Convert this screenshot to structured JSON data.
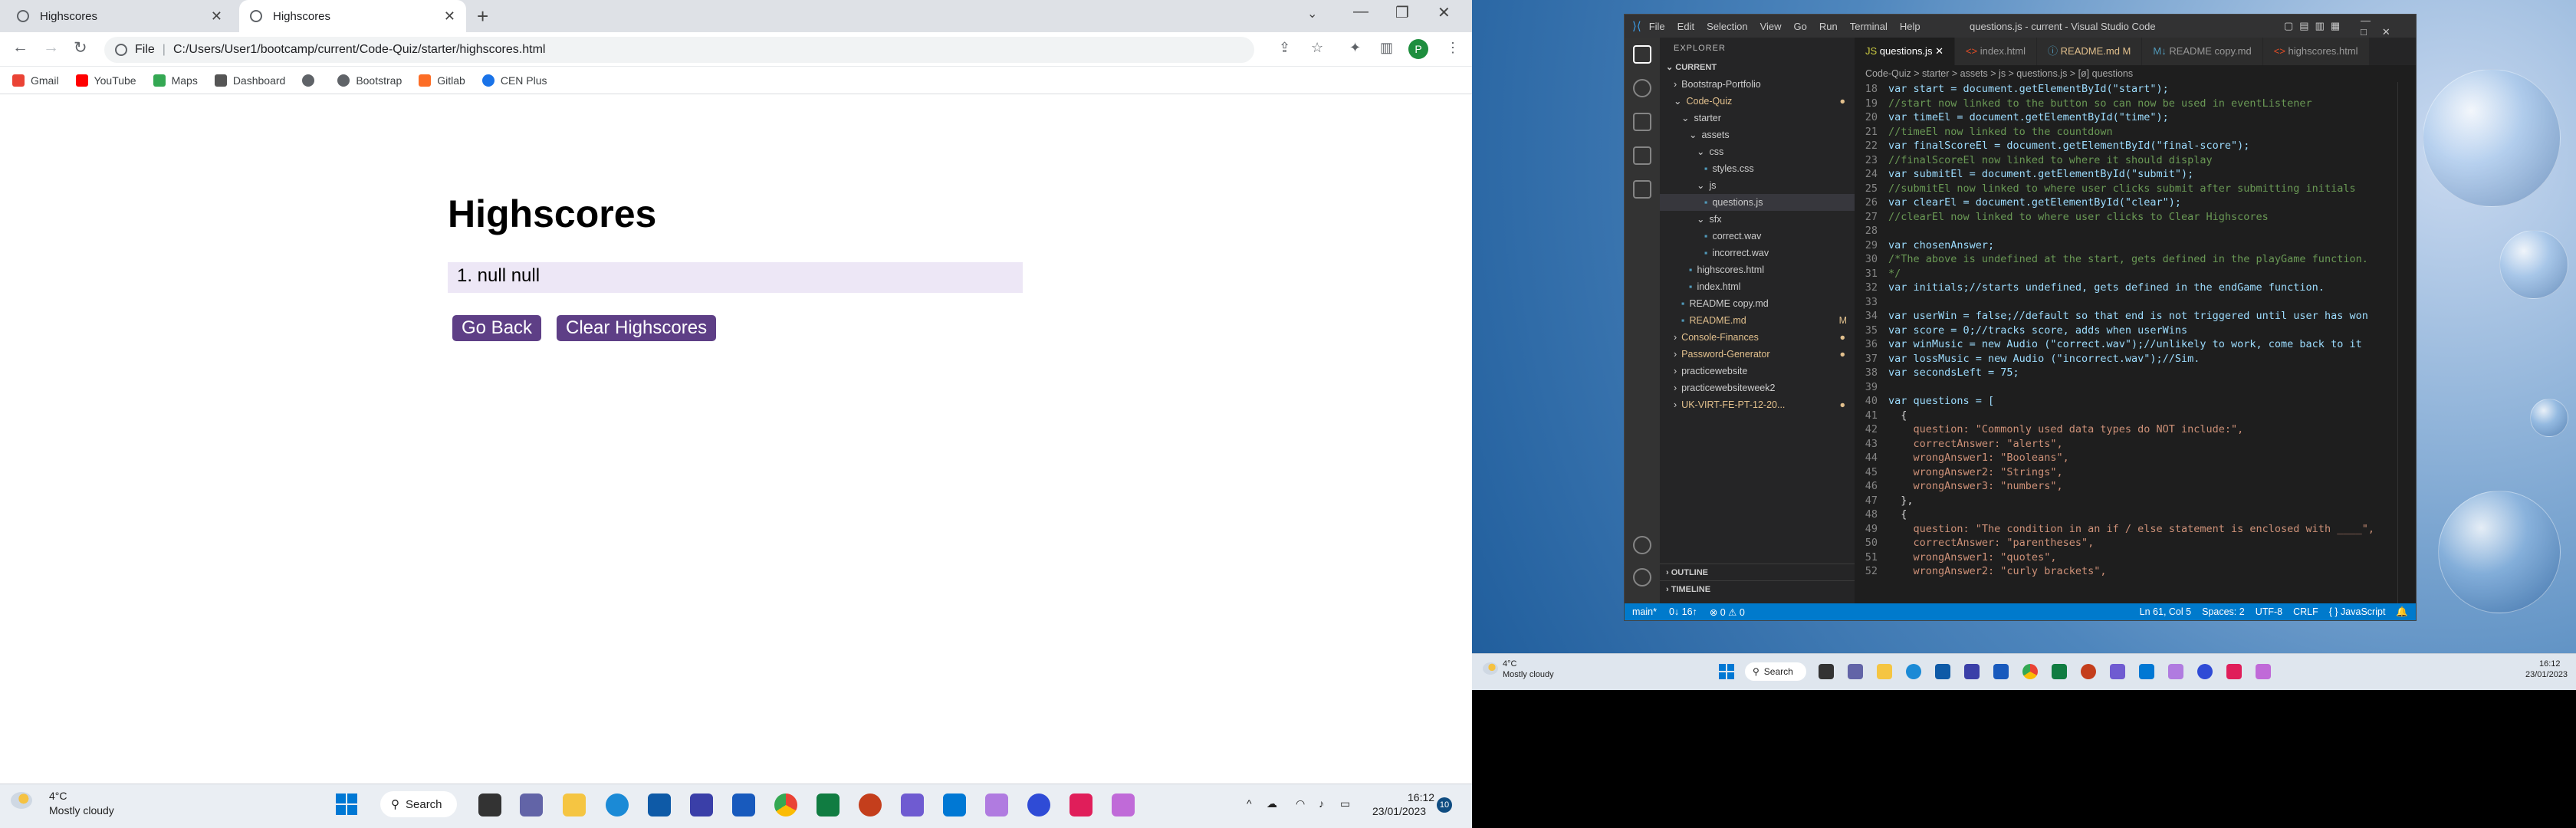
{
  "browser": {
    "tabs": [
      {
        "title": "Highscores"
      },
      {
        "title": "Highscores"
      }
    ],
    "url_prefix": "File",
    "url": "C:/Users/User1/bootcamp/current/Code-Quiz/starter/highscores.html",
    "profile_initial": "P",
    "bookmarks": [
      {
        "label": "Gmail",
        "color": "#ea4335"
      },
      {
        "label": "YouTube",
        "color": "#ff0000"
      },
      {
        "label": "Maps",
        "color": "#34a853"
      },
      {
        "label": "Dashboard",
        "color": "#555555"
      },
      {
        "label": "",
        "color": "#5f6368"
      },
      {
        "label": "Bootstrap",
        "color": "#5f6368"
      },
      {
        "label": "Gitlab",
        "color": "#fc6d26"
      },
      {
        "label": "CEN Plus",
        "color": "#1a73e8"
      }
    ]
  },
  "page": {
    "heading": "Highscores",
    "scores": [
      "1. null null"
    ],
    "go_back": "Go Back",
    "clear": "Clear Highscores"
  },
  "taskbar_left": {
    "weather_temp": "4°C",
    "weather_desc": "Mostly cloudy",
    "search": "Search",
    "time": "16:12",
    "date": "23/01/2023",
    "notification_count": "10"
  },
  "vscode": {
    "menu": [
      "File",
      "Edit",
      "Selection",
      "View",
      "Go",
      "Run",
      "Terminal",
      "Help"
    ],
    "title": "questions.js - current - Visual Studio Code",
    "explorer_label": "EXPLORER",
    "current_label": "CURRENT",
    "tree": [
      {
        "label": "Bootstrap-Portfolio",
        "indent": 1,
        "kind": "folder-closed"
      },
      {
        "label": "Code-Quiz",
        "indent": 1,
        "kind": "folder-open",
        "color": "#e2c08d"
      },
      {
        "label": "starter",
        "indent": 2,
        "kind": "folder-open"
      },
      {
        "label": "assets",
        "indent": 3,
        "kind": "folder-open"
      },
      {
        "label": "css",
        "indent": 4,
        "kind": "folder-open"
      },
      {
        "label": "styles.css",
        "indent": 5,
        "kind": "file"
      },
      {
        "label": "js",
        "indent": 4,
        "kind": "folder-open"
      },
      {
        "label": "questions.js",
        "indent": 5,
        "kind": "file",
        "selected": true
      },
      {
        "label": "sfx",
        "indent": 4,
        "kind": "folder-open"
      },
      {
        "label": "correct.wav",
        "indent": 5,
        "kind": "file"
      },
      {
        "label": "incorrect.wav",
        "indent": 5,
        "kind": "file"
      },
      {
        "label": "highscores.html",
        "indent": 3,
        "kind": "file"
      },
      {
        "label": "index.html",
        "indent": 3,
        "kind": "file"
      },
      {
        "label": "README copy.md",
        "indent": 2,
        "kind": "file"
      },
      {
        "label": "README.md",
        "indent": 2,
        "kind": "file",
        "color": "#e2c08d",
        "badge": "M"
      },
      {
        "label": "Console-Finances",
        "indent": 1,
        "kind": "folder-closed",
        "color": "#e2c08d"
      },
      {
        "label": "Password-Generator",
        "indent": 1,
        "kind": "folder-closed",
        "color": "#e2c08d"
      },
      {
        "label": "practicewebsite",
        "indent": 1,
        "kind": "folder-closed"
      },
      {
        "label": "practicewebsiteweek2",
        "indent": 1,
        "kind": "folder-closed"
      },
      {
        "label": "UK-VIRT-FE-PT-12-20...",
        "indent": 1,
        "kind": "folder-closed",
        "color": "#e2c08d"
      }
    ],
    "outline_label": "OUTLINE",
    "timeline_label": "TIMELINE",
    "tabs": [
      "questions.js",
      "index.html",
      "README.md M",
      "README copy.md",
      "highscores.html"
    ],
    "breadcrumb": "Code-Quiz > starter > assets > js > questions.js > [ø] questions",
    "code": [
      {
        "n": "18",
        "t": "var start = document.getElementById(\"start\");"
      },
      {
        "n": "19",
        "t": "//start now linked to the button so can now be used in eventListener"
      },
      {
        "n": "20",
        "t": "var timeEl = document.getElementById(\"time\");"
      },
      {
        "n": "21",
        "t": "//timeEl now linked to the countdown"
      },
      {
        "n": "22",
        "t": "var finalScoreEl = document.getElementById(\"final-score\");"
      },
      {
        "n": "23",
        "t": "//finalScoreEl now linked to where it should display"
      },
      {
        "n": "24",
        "t": "var submitEl = document.getElementById(\"submit\");"
      },
      {
        "n": "25",
        "t": "//submitEl now linked to where user clicks submit after submitting initials"
      },
      {
        "n": "26",
        "t": "var clearEl = document.getElementById(\"clear\");"
      },
      {
        "n": "27",
        "t": "//clearEl now linked to where user clicks to Clear Highscores"
      },
      {
        "n": "28",
        "t": ""
      },
      {
        "n": "29",
        "t": "var chosenAnswer;"
      },
      {
        "n": "30",
        "t": "/*The above is undefined at the start, gets defined in the playGame function."
      },
      {
        "n": "31",
        "t": "*/"
      },
      {
        "n": "32",
        "t": "var initials;//starts undefined, gets defined in the endGame function."
      },
      {
        "n": "33",
        "t": ""
      },
      {
        "n": "34",
        "t": "var userWin = false;//default so that end is not triggered until user has won"
      },
      {
        "n": "35",
        "t": "var score = 0;//tracks score, adds when userWins"
      },
      {
        "n": "36",
        "t": "var winMusic = new Audio (\"correct.wav\");//unlikely to work, come back to it"
      },
      {
        "n": "37",
        "t": "var lossMusic = new Audio (\"incorrect.wav\");//Sim."
      },
      {
        "n": "38",
        "t": "var secondsLeft = 75;"
      },
      {
        "n": "39",
        "t": ""
      },
      {
        "n": "40",
        "t": "var questions = ["
      },
      {
        "n": "41",
        "t": "  {"
      },
      {
        "n": "42",
        "t": "    question: \"Commonly used data types do NOT include:\","
      },
      {
        "n": "43",
        "t": "    correctAnswer: \"alerts\","
      },
      {
        "n": "44",
        "t": "    wrongAnswer1: \"Booleans\","
      },
      {
        "n": "45",
        "t": "    wrongAnswer2: \"Strings\","
      },
      {
        "n": "46",
        "t": "    wrongAnswer3: \"numbers\","
      },
      {
        "n": "47",
        "t": "  },"
      },
      {
        "n": "48",
        "t": "  {"
      },
      {
        "n": "49",
        "t": "    question: \"The condition in an if / else statement is enclosed with ____\","
      },
      {
        "n": "50",
        "t": "    correctAnswer: \"parentheses\","
      },
      {
        "n": "51",
        "t": "    wrongAnswer1: \"quotes\","
      },
      {
        "n": "52",
        "t": "    wrongAnswer2: \"curly brackets\","
      }
    ],
    "status_left": [
      "main*",
      "0↓ 16↑",
      "⊗ 0 ⚠ 0"
    ],
    "status_right": [
      "Ln 61, Col 5",
      "Spaces: 2",
      "UTF-8",
      "CRLF",
      "{ } JavaScript"
    ]
  },
  "taskbar_right": {
    "weather_temp": "4°C",
    "weather_desc": "Mostly cloudy",
    "search": "Search",
    "time": "16:12",
    "date": "23/01/2023"
  }
}
